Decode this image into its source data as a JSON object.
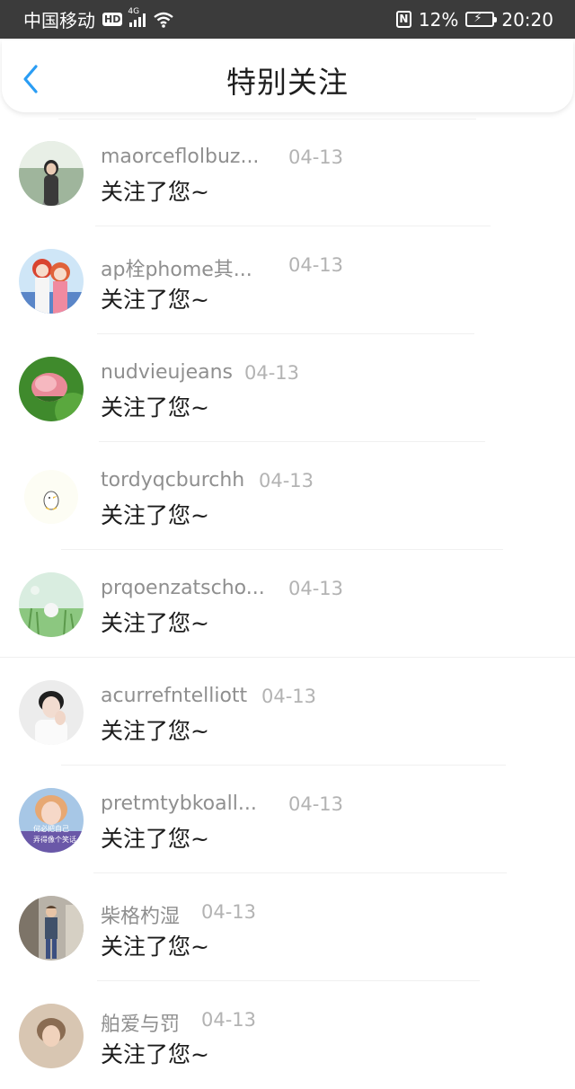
{
  "status_bar": {
    "carrier": "中国移动",
    "hd_badge": "HD",
    "network": "4G",
    "battery": "12%",
    "time": "20:20"
  },
  "header": {
    "title": "特别关注"
  },
  "list": [
    {
      "name": "maorceflolbuz...",
      "date": "04-13",
      "message": "关注了您~",
      "avatar_icon": "girl-on-road-avatar"
    },
    {
      "name": "ap栓phome其...",
      "date": "04-13",
      "message": "关注了您~",
      "avatar_icon": "anime-couple-avatar"
    },
    {
      "name": "nudvieujeans",
      "date": "04-13",
      "message": "关注了您~",
      "avatar_icon": "pink-flower-avatar"
    },
    {
      "name": "tordyqcburchh",
      "date": "04-13",
      "message": "关注了您~",
      "avatar_icon": "cartoon-duck-avatar"
    },
    {
      "name": "prqoenzatscho...",
      "date": "04-13",
      "message": "关注了您~",
      "avatar_icon": "dandelion-avatar"
    },
    {
      "name": "acurrefntelliott",
      "date": "04-13",
      "message": "关注了您~",
      "avatar_icon": "young-man-avatar"
    },
    {
      "name": "pretmtybkoall...",
      "date": "04-13",
      "message": "关注了您~",
      "avatar_icon": "girl-photo-avatar",
      "avatar_caption_1": "何必把自己",
      "avatar_caption_2": "弄得像个笑话"
    },
    {
      "name": "柴格杓湿",
      "date": "04-13",
      "message": "关注了您~",
      "avatar_icon": "street-man-avatar"
    },
    {
      "name": "舶爱与罚",
      "date": "04-13",
      "message": "关注了您~",
      "avatar_icon": "partial-avatar"
    }
  ]
}
